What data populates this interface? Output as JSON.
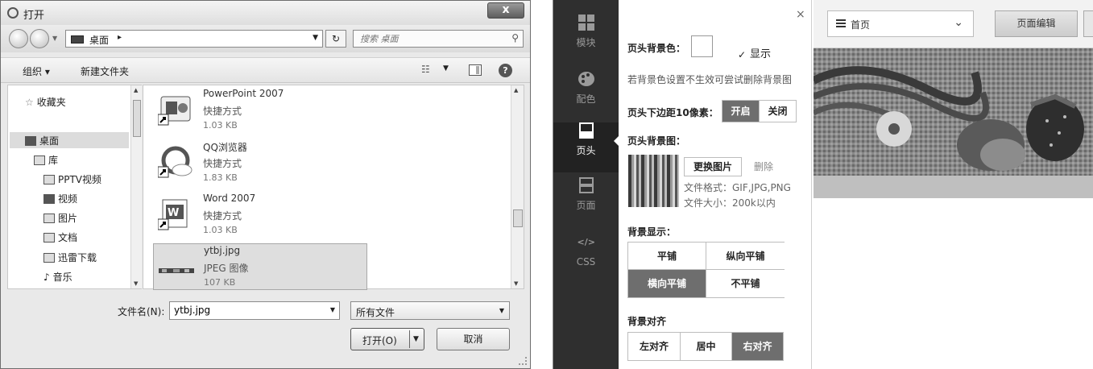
{
  "dialog": {
    "title": "打开",
    "close_label": "x",
    "address": {
      "location": "桌面",
      "arrow": "▸"
    },
    "search": {
      "placeholder": "搜索 桌面"
    },
    "toolbar": {
      "organize": "组织 ▾",
      "new_folder": "新建文件夹"
    },
    "nav_pane": {
      "favorites": "收藏夹",
      "desktop": "桌面",
      "library": "库",
      "libraries": [
        "PPTV视频",
        "视频",
        "图片",
        "文档",
        "迅雷下载",
        "音乐"
      ]
    },
    "files": [
      {
        "name": "PowerPoint 2007",
        "type": "快捷方式",
        "size": "1.03 KB",
        "icon": "powerpoint-icon"
      },
      {
        "name": "QQ浏览器",
        "type": "快捷方式",
        "size": "1.83 KB",
        "icon": "qq-browser-icon"
      },
      {
        "name": "Word 2007",
        "type": "快捷方式",
        "size": "1.03 KB",
        "icon": "word-icon"
      },
      {
        "name": "ytbj.jpg",
        "type": "JPEG 图像",
        "size": "107 KB",
        "icon": "image-thumbnail-icon"
      }
    ],
    "filename_label": "文件名(N):",
    "filename_value": "ytbj.jpg",
    "filetype_value": "所有文件",
    "open_label": "打开(O)",
    "cancel_label": "取消"
  },
  "editor": {
    "sidebar": [
      {
        "label": "模块",
        "icon": "grid-icon"
      },
      {
        "label": "配色",
        "icon": "palette-icon"
      },
      {
        "label": "页头",
        "icon": "header-icon"
      },
      {
        "label": "页面",
        "icon": "page-icon"
      },
      {
        "label": "CSS",
        "icon": "code-icon",
        "glyph": "</>"
      }
    ],
    "panel": {
      "close": "×",
      "header_bg_color_label": "页头背景色：",
      "show_label": "显示",
      "show_checked": true,
      "hint": "若背景色设置不生效可尝试删除背景图",
      "margin_label": "页头下边距10像素：",
      "margin_on": "开启",
      "margin_off": "关闭",
      "bg_image_label": "页头背景图：",
      "change_image": "更换图片",
      "delete": "删除",
      "format_text": "文件格式：GIF,JPG,PNG",
      "size_text": "文件大小：200k以内",
      "bg_display_label": "背景显示：",
      "display_options": [
        "平铺",
        "纵向平铺",
        "横向平铺",
        "不平铺"
      ],
      "display_selected": "横向平铺",
      "align_label": "背景对齐",
      "align_options": [
        "左对齐",
        "居中",
        "右对齐"
      ],
      "align_selected": "右对齐"
    },
    "canvas": {
      "page_select": "首页",
      "edit_button": "页面编辑"
    }
  }
}
